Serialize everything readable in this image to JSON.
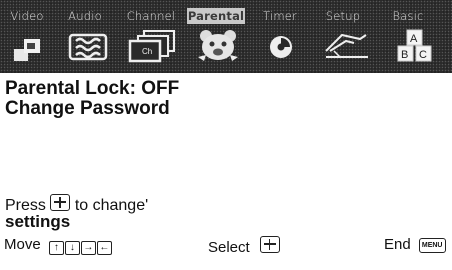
{
  "menu": {
    "tabs": [
      {
        "label": "Video",
        "icon": "video-icon"
      },
      {
        "label": "Audio",
        "icon": "audio-icon"
      },
      {
        "label": "Channel",
        "icon": "channel-icon"
      },
      {
        "label": "Parental",
        "icon": "parental-bear-icon"
      },
      {
        "label": "Timer",
        "icon": "timer-icon"
      },
      {
        "label": "Setup",
        "icon": "setup-icon"
      },
      {
        "label": "Basic",
        "icon": "basic-abc-icon"
      }
    ],
    "active_tab": "Parental",
    "basic_icon_letters": [
      "A",
      "B",
      "C"
    ]
  },
  "content": {
    "lines": [
      "Parental Lock:  OFF",
      "Change Password"
    ],
    "press_prefix": "Press",
    "press_suffix": "to  change'",
    "press_line2": "settings"
  },
  "footer": {
    "move_label": "Move",
    "select_label": "Select",
    "end_label": "End",
    "menu_key_label": "MENU"
  }
}
